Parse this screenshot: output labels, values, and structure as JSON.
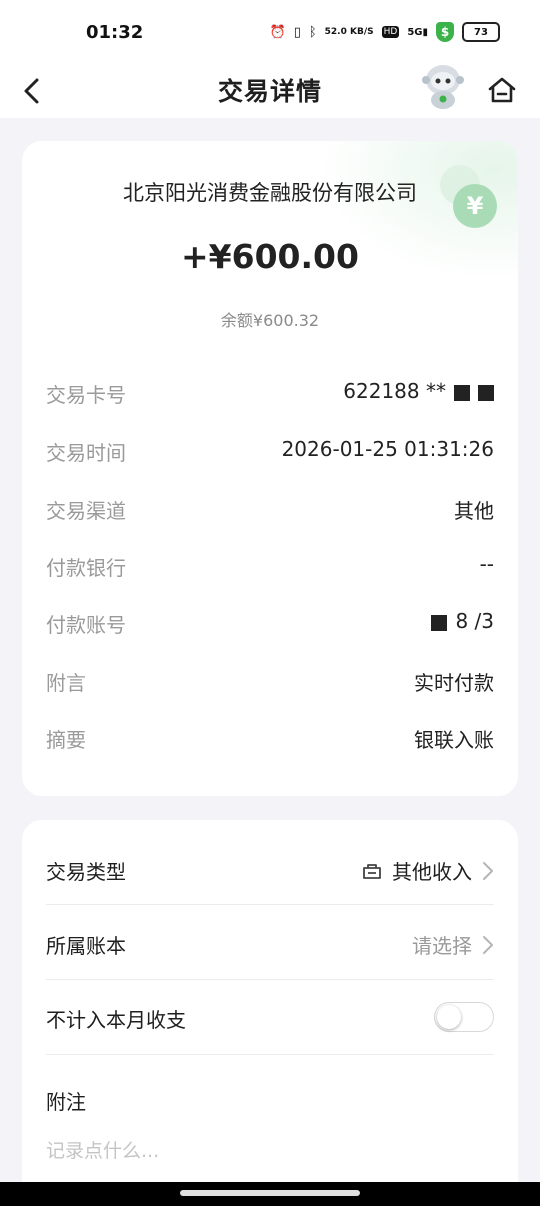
{
  "status_bar": {
    "time": "01:32",
    "network_speed": "52.0 KB/S",
    "hd": "HD",
    "signal": "5G",
    "battery": "73",
    "icons": [
      "alarm-icon",
      "vibrate-icon",
      "bluetooth-icon",
      "hd-icon",
      "signal-icon",
      "security-shield-icon",
      "battery-icon"
    ]
  },
  "header": {
    "title": "交易详情",
    "icons": [
      "back-arrow-icon",
      "robot-assistant-icon",
      "home-icon"
    ]
  },
  "summary": {
    "merchant": "北京阳光消费金融股份有限公司",
    "amount": "+¥600.00",
    "balance": "余额¥600.32",
    "coin_symbol": "¥"
  },
  "details": [
    {
      "label": "交易卡号",
      "value": "622188 **"
    },
    {
      "label": "交易时间",
      "value": "2026-01-25 01:31:26"
    },
    {
      "label": "交易渠道",
      "value": "其他"
    },
    {
      "label": "付款银行",
      "value": "--"
    },
    {
      "label": "付款账号",
      "value": "8 /3"
    },
    {
      "label": "附言",
      "value": "实时付款"
    },
    {
      "label": "摘要",
      "value": "银联入账"
    }
  ],
  "settings": {
    "type_label": "交易类型",
    "type_value": "其他收入",
    "ledger_label": "所属账本",
    "ledger_value": "请选择",
    "exclude_label": "不计入本月收支",
    "exclude_on": false,
    "memo_label": "附注",
    "memo_placeholder": "记录点什么..."
  },
  "colors": {
    "accent_green": "#3bb34a",
    "coin_green": "#a9dcb6",
    "background": "#f4f4f8"
  }
}
